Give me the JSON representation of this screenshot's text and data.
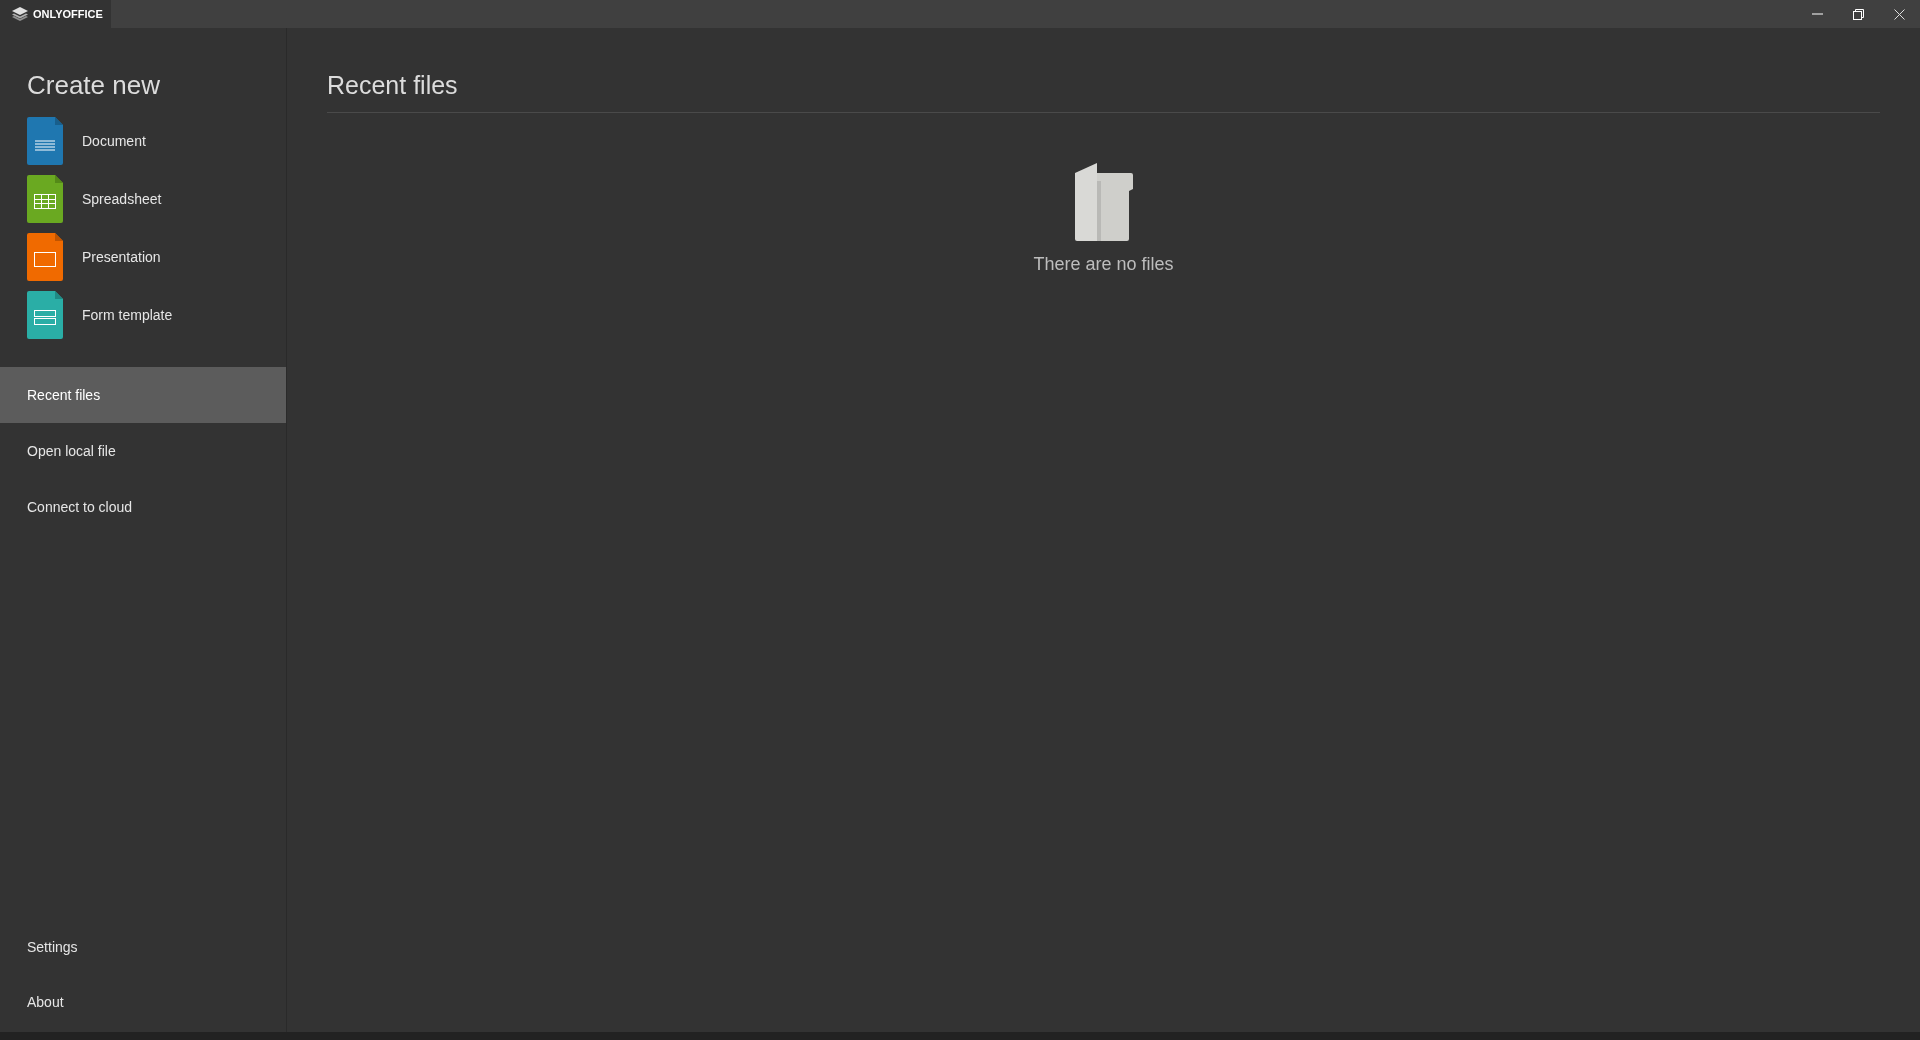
{
  "window": {
    "tab": "ONLYOFFICE"
  },
  "sidebar": {
    "heading": "Create new",
    "create_items": [
      {
        "kind": "document",
        "label": "Document"
      },
      {
        "kind": "spreadsheet",
        "label": "Spreadsheet"
      },
      {
        "kind": "presentation",
        "label": "Presentation"
      },
      {
        "kind": "form",
        "label": "Form template"
      }
    ],
    "nav_items": [
      {
        "label": "Recent files",
        "selected": true
      },
      {
        "label": "Open local file",
        "selected": false
      },
      {
        "label": "Connect to cloud",
        "selected": false
      }
    ],
    "bottom_items": [
      {
        "label": "Settings"
      },
      {
        "label": "About"
      }
    ]
  },
  "main": {
    "title": "Recent files",
    "empty_message": "There are no files"
  }
}
